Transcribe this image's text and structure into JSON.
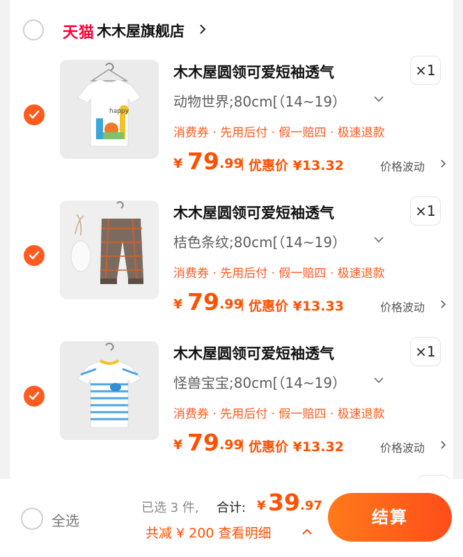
{
  "store": {
    "logo_text": "天猫",
    "name": "木木屋旗舰店"
  },
  "items": [
    {
      "title": "木木屋圆领可爱短袖透气",
      "variant": "动物世界;80cm[（14~19）",
      "tags": "消费券 · 先用后付 · 假一赔四 · 极速退款",
      "qty": "×1",
      "price_yen": "¥",
      "price_int": "79",
      "price_dec": ".99",
      "discount": "优惠价 ¥13.32",
      "fluct": "价格波动",
      "thumb_icon": "white-tshirt-animals-icon"
    },
    {
      "title": "木木屋圆领可爱短袖透气",
      "variant": "桔色条纹;80cm[（14~19）",
      "tags": "消费券 · 先用后付 · 假一赔四 · 极速退款",
      "qty": "×1",
      "price_yen": "¥",
      "price_int": "79",
      "price_dec": ".99",
      "discount": "优惠价 ¥13.33",
      "fluct": "价格波动",
      "thumb_icon": "plaid-pants-icon"
    },
    {
      "title": "木木屋圆领可爱短袖透气",
      "variant": "怪兽宝宝;80cm[（14~19）",
      "tags": "消费券 · 先用后付 · 假一赔四 · 极速退款",
      "qty": "×1",
      "price_yen": "¥",
      "price_int": "79",
      "price_dec": ".99",
      "discount": "优惠价 ¥13.32",
      "fluct": "价格波动",
      "thumb_icon": "striped-tshirt-icon"
    }
  ],
  "footer": {
    "select_all": "全选",
    "selected_count": "已选 3 件,",
    "total_label": "合计:",
    "total_yen": "¥",
    "total_int": "39",
    "total_dec": ".97",
    "savings": "共减 ¥ 200  查看明细",
    "checkout": "结算"
  },
  "colors": {
    "accent": "#ff5000",
    "tmall_red": "#ff0036",
    "checkbox_on": "#ff5a1f"
  }
}
